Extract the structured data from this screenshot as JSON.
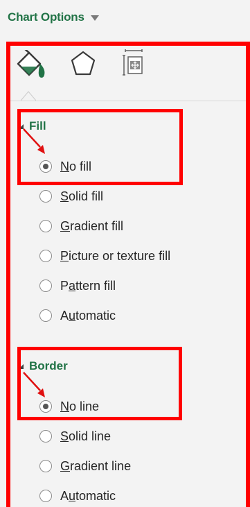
{
  "header": {
    "title": "Chart Options"
  },
  "tabs": [
    {
      "name": "Fill & Line",
      "icon": "paint-bucket-icon"
    },
    {
      "name": "Effects",
      "icon": "pentagon-icon"
    },
    {
      "name": "Size & Properties",
      "icon": "size-properties-icon"
    }
  ],
  "fill": {
    "label": "Fill",
    "options": [
      {
        "pre": "",
        "ul": "N",
        "post": "o fill",
        "checked": true
      },
      {
        "pre": "",
        "ul": "S",
        "post": "olid fill",
        "checked": false
      },
      {
        "pre": "",
        "ul": "G",
        "post": "radient fill",
        "checked": false
      },
      {
        "pre": "",
        "ul": "P",
        "post": "icture or texture fill",
        "checked": false
      },
      {
        "pre": "P",
        "ul": "a",
        "post": "ttern fill",
        "checked": false
      },
      {
        "pre": "A",
        "ul": "u",
        "post": "tomatic",
        "checked": false
      }
    ]
  },
  "border": {
    "label": "Border",
    "options": [
      {
        "pre": "",
        "ul": "N",
        "post": "o line",
        "checked": true
      },
      {
        "pre": "",
        "ul": "S",
        "post": "olid line",
        "checked": false
      },
      {
        "pre": "",
        "ul": "G",
        "post": "radient line",
        "checked": false
      },
      {
        "pre": "A",
        "ul": "u",
        "post": "tomatic",
        "checked": false
      }
    ]
  },
  "colors": {
    "accent": "#217346",
    "highlight": "#ff0000"
  }
}
